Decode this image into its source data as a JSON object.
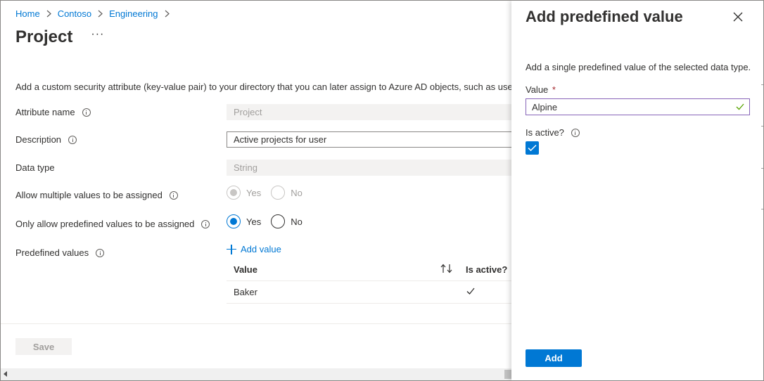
{
  "breadcrumb": {
    "items": [
      "Home",
      "Contoso",
      "Engineering"
    ]
  },
  "page": {
    "title": "Project",
    "more_label": "···",
    "intro": "Add a custom security attribute (key-value pair) to your directory that you can later assign to Azure AD objects, such as use"
  },
  "form": {
    "attribute_name_label": "Attribute name",
    "attribute_name_value": "Project",
    "description_label": "Description",
    "description_value": "Active projects for user",
    "data_type_label": "Data type",
    "data_type_value": "String",
    "allow_multiple_label": "Allow multiple values to be assigned",
    "allow_multiple_yes": "Yes",
    "allow_multiple_no": "No",
    "allow_multiple_selected": "Yes",
    "only_predefined_label": "Only allow predefined values to be assigned",
    "only_predefined_yes": "Yes",
    "only_predefined_no": "No",
    "only_predefined_selected": "Yes",
    "predefined_values_label": "Predefined values",
    "add_value_label": "Add value"
  },
  "table": {
    "columns": [
      "Value",
      "Is active?"
    ],
    "rows": [
      {
        "value": "Baker",
        "is_active": true
      }
    ]
  },
  "footer": {
    "save_label": "Save"
  },
  "panel": {
    "title": "Add predefined value",
    "description": "Add a single predefined value of the selected data type.",
    "value_label": "Value",
    "required_marker": "*",
    "value_input": "Alpine",
    "is_active_label": "Is active?",
    "is_active_checked": true,
    "add_button_label": "Add"
  },
  "colors": {
    "accent": "#0078d4",
    "input_focus_border": "#8764b8",
    "valid_check": "#57a300",
    "required": "#a4262c"
  }
}
